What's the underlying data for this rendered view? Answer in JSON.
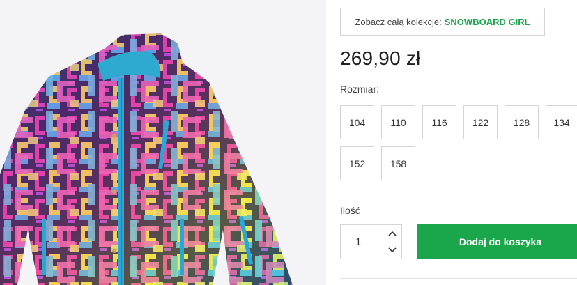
{
  "collection": {
    "prefix": "Zobacz całą kolekcje:",
    "name": "SNOWBOARD GIRL"
  },
  "price": "269,90 zł",
  "size_label": "Rozmiar:",
  "sizes": [
    "104",
    "110",
    "116",
    "122",
    "128",
    "134",
    "152",
    "158"
  ],
  "quantity": {
    "label": "Ilość",
    "value": "1"
  },
  "cart_button": "Dodaj do koszyka",
  "colors": {
    "accent": "#1aa64a",
    "border": "#d4d4d4",
    "text": "#222222"
  },
  "icons": [
    "chevron-up-icon",
    "chevron-down-icon"
  ]
}
